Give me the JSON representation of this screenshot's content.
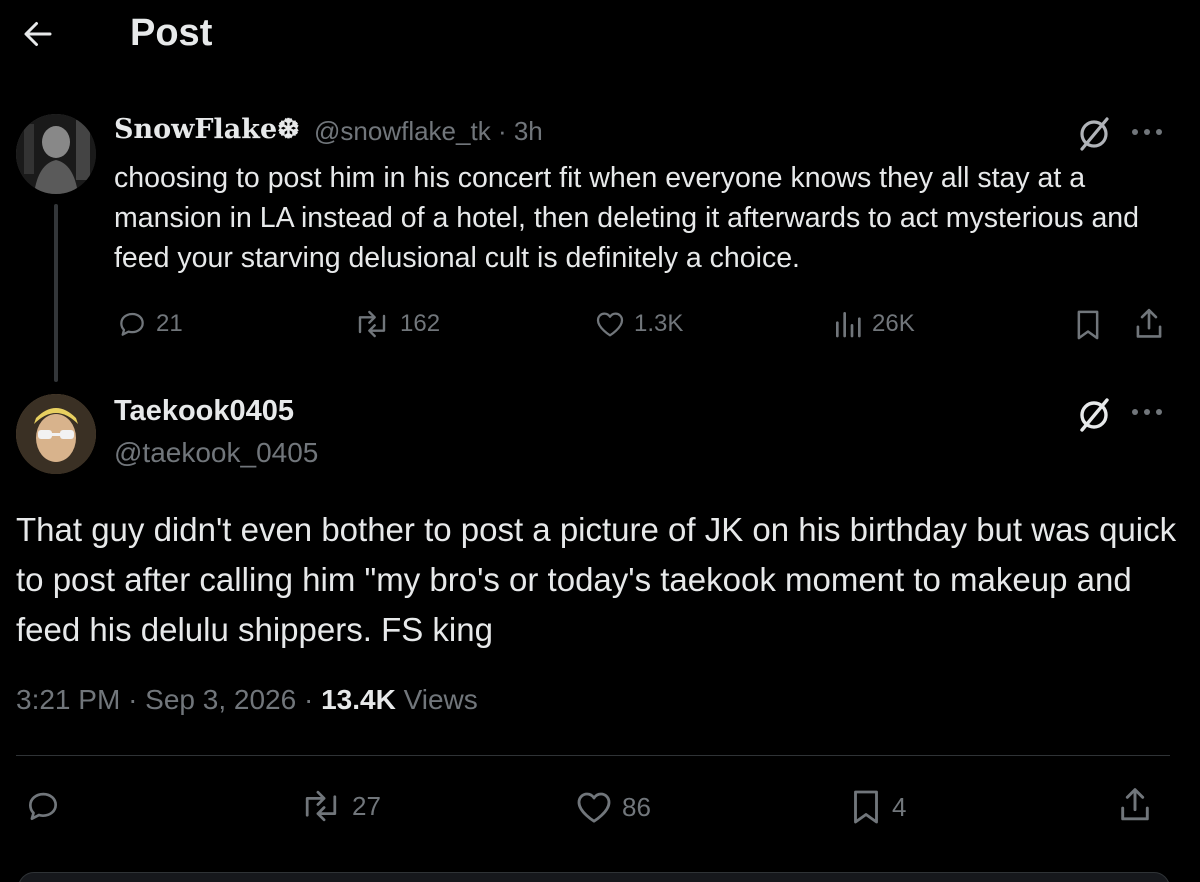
{
  "header": {
    "title": "Post"
  },
  "parent_post": {
    "display_name": "SnowFlake❆",
    "handle": "@snowflake_tk",
    "separator": "·",
    "time": "3h",
    "text": "choosing to post him in his concert fit when everyone knows they all stay at a mansion in LA instead of a hotel, then deleting it afterwards to act mysterious and feed your starving delusional cult is definitely a choice.",
    "stats": {
      "replies": "21",
      "reposts": "162",
      "likes": "1.3K",
      "views": "26K"
    }
  },
  "main_post": {
    "display_name": "Taekook0405",
    "handle": "@taekook_0405",
    "text": "That guy didn't even bother to post a picture of JK on his birthday but was quick to post after calling him \"my bro's or today's taekook moment to makeup and feed his delulu shippers. FS king",
    "time": "3:21 PM",
    "date": "Sep 3, 2026",
    "separator": "·",
    "views_count": "13.4K",
    "views_label": "Views",
    "stats": {
      "reposts": "27",
      "likes": "86",
      "bookmarks": "4"
    }
  },
  "icons": {
    "back": "arrow-left-icon",
    "grok": "grok-icon",
    "more": "more-icon",
    "reply": "reply-icon",
    "repost": "repost-icon",
    "like": "heart-icon",
    "views": "views-icon",
    "bookmark": "bookmark-icon",
    "share": "share-icon"
  },
  "colors": {
    "background": "#000000",
    "text": "#e7e9ea",
    "muted": "#71767b",
    "divider": "#2f3336"
  }
}
